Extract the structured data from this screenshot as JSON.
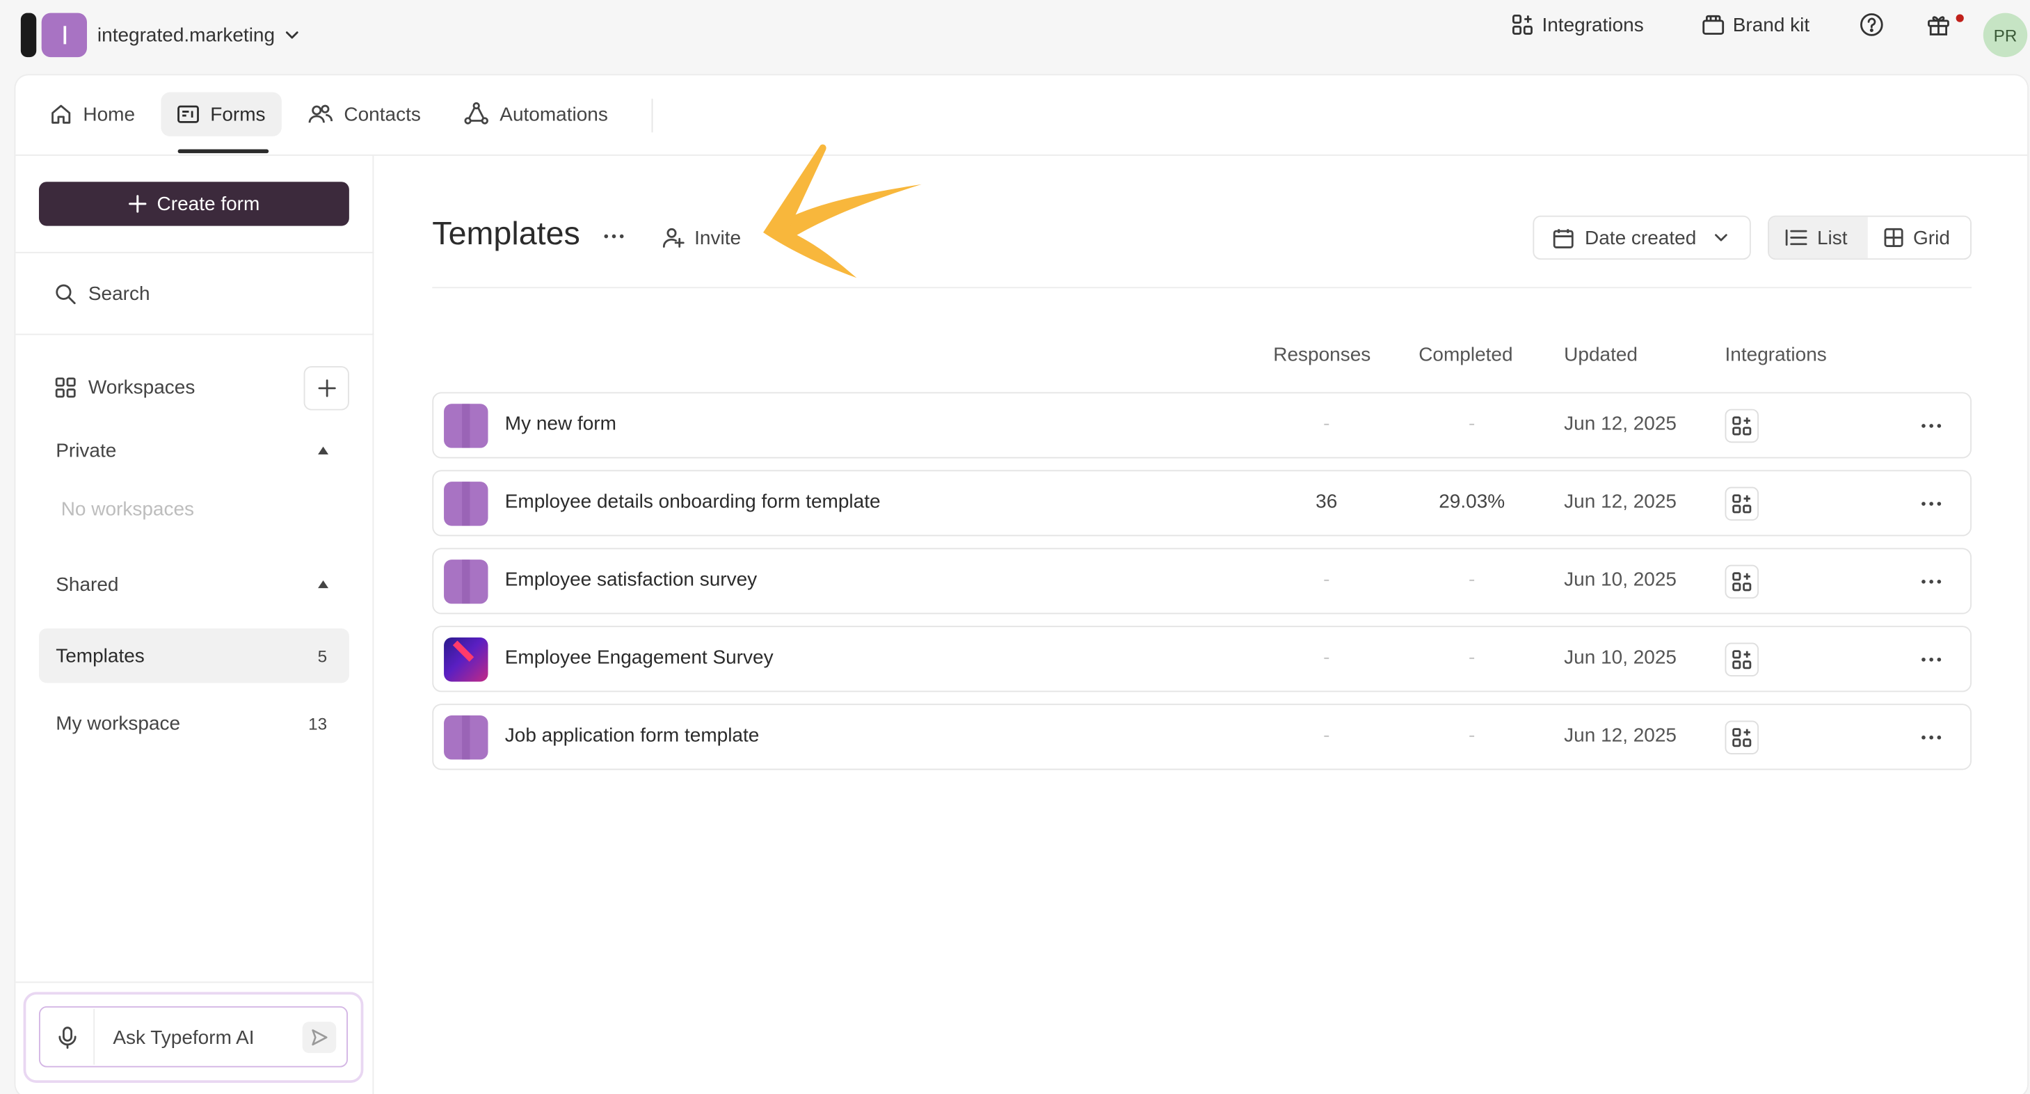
{
  "topbar": {
    "account_name": "integrated.marketing",
    "integrations_label": "Integrations",
    "brand_kit_label": "Brand kit",
    "avatar_initials": "PR"
  },
  "nav": {
    "home": "Home",
    "forms": "Forms",
    "contacts": "Contacts",
    "automations": "Automations"
  },
  "sidebar": {
    "create_form": "Create form",
    "search": "Search",
    "workspaces": "Workspaces",
    "private": "Private",
    "no_workspaces": "No workspaces",
    "shared": "Shared",
    "items": [
      {
        "label": "Templates",
        "count": "5"
      },
      {
        "label": "My workspace",
        "count": "13"
      }
    ],
    "ai_placeholder": "Ask Typeform AI"
  },
  "content": {
    "title": "Templates",
    "invite": "Invite",
    "sort_label": "Date created",
    "view_list": "List",
    "view_grid": "Grid",
    "columns": {
      "responses": "Responses",
      "completed": "Completed",
      "updated": "Updated",
      "integrations": "Integrations"
    },
    "rows": [
      {
        "name": "My new form",
        "responses": "-",
        "completed": "-",
        "updated": "Jun 12, 2025"
      },
      {
        "name": "Employee details onboarding form template",
        "responses": "36",
        "completed": "29.03%",
        "updated": "Jun 12, 2025"
      },
      {
        "name": "Employee satisfaction survey",
        "responses": "-",
        "completed": "-",
        "updated": "Jun 10, 2025"
      },
      {
        "name": "Employee Engagement Survey",
        "responses": "-",
        "completed": "-",
        "updated": "Jun 10, 2025"
      },
      {
        "name": "Job application form template",
        "responses": "-",
        "completed": "-",
        "updated": "Jun 12, 2025"
      }
    ]
  },
  "colors": {
    "brand_purple": "#a873c3",
    "create_button": "#3c2a3c",
    "arrow_annotation": "#f8b73c",
    "notification_dot": "#c0201a",
    "avatar_bg": "#c6e4c4"
  }
}
